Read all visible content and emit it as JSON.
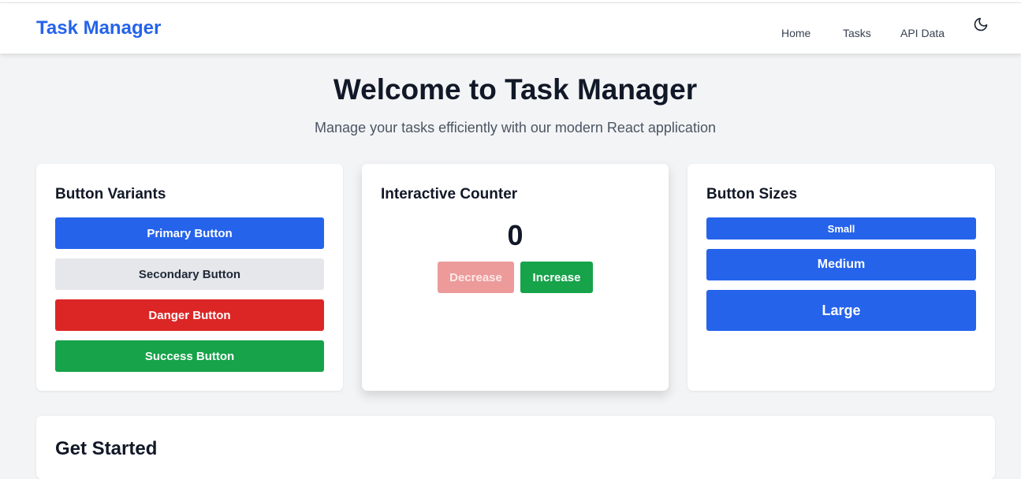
{
  "navbar": {
    "brand": "Task Manager",
    "links": [
      "Home",
      "Tasks",
      "API Data"
    ],
    "theme_icon": "moon-icon"
  },
  "hero": {
    "title": "Welcome to Task Manager",
    "subtitle": "Manage your tasks efficiently with our modern React application"
  },
  "variants_card": {
    "title": "Button Variants",
    "primary": "Primary Button",
    "secondary": "Secondary Button",
    "danger": "Danger Button",
    "success": "Success Button"
  },
  "counter_card": {
    "title": "Interactive Counter",
    "value": "0",
    "decrease": "Decrease",
    "increase": "Increase"
  },
  "sizes_card": {
    "title": "Button Sizes",
    "small": "Small",
    "medium": "Medium",
    "large": "Large"
  },
  "get_started": {
    "title": "Get Started"
  },
  "colors": {
    "brand": "#2563eb",
    "danger": "#dc2626",
    "success": "#16a34a",
    "secondary": "#e5e7eb"
  }
}
